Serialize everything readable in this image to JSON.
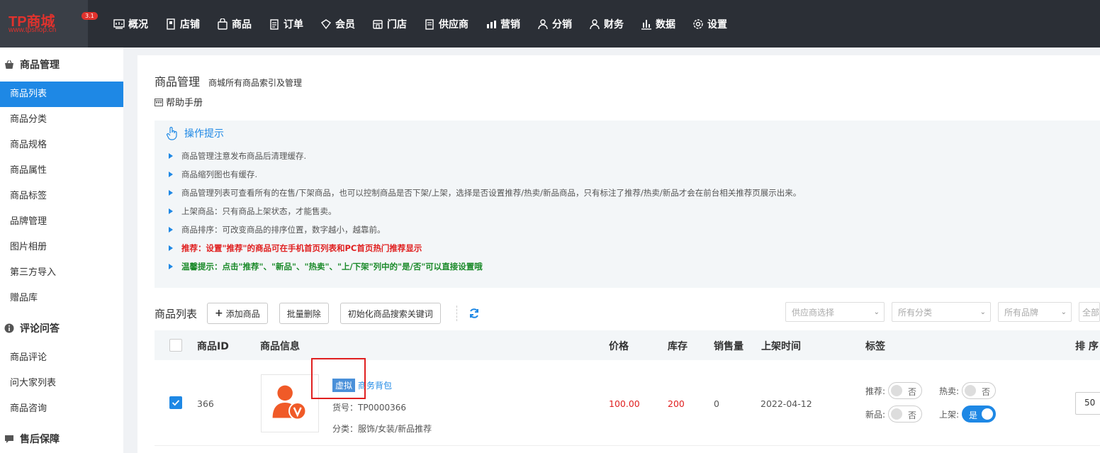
{
  "logo": {
    "main": "TP商城",
    "sub": "www.tpshop.cn",
    "version": "3.1"
  },
  "topnav": [
    {
      "label": "概况",
      "icon": "overview-icon"
    },
    {
      "label": "店铺",
      "icon": "store-icon"
    },
    {
      "label": "商品",
      "icon": "goods-icon"
    },
    {
      "label": "订单",
      "icon": "order-icon"
    },
    {
      "label": "会员",
      "icon": "member-icon"
    },
    {
      "label": "门店",
      "icon": "shop-icon"
    },
    {
      "label": "供应商",
      "icon": "supplier-icon"
    },
    {
      "label": "营销",
      "icon": "marketing-icon"
    },
    {
      "label": "分销",
      "icon": "distribution-icon"
    },
    {
      "label": "财务",
      "icon": "finance-icon"
    },
    {
      "label": "数据",
      "icon": "data-icon"
    },
    {
      "label": "设置",
      "icon": "settings-icon"
    }
  ],
  "sidebar": {
    "group1": "商品管理",
    "items1": [
      "商品列表",
      "商品分类",
      "商品规格",
      "商品属性",
      "商品标签",
      "品牌管理",
      "图片相册",
      "第三方导入",
      "赠品库"
    ],
    "group2": "评论问答",
    "items2": [
      "商品评论",
      "问大家列表",
      "商品咨询"
    ],
    "group3": "售后保障"
  },
  "page": {
    "title": "商品管理",
    "desc": "商城所有商品索引及管理",
    "help": "帮助手册"
  },
  "tips": {
    "title": "操作提示",
    "items": [
      "商品管理注意发布商品后清理缓存.",
      "商品缩列图也有缓存.",
      "商品管理列表可查看所有的在售/下架商品，也可以控制商品是否下架/上架，选择是否设置推荐/热卖/新品商品，只有标注了推荐/热卖/新品才会在前台相关推荐页展示出来。",
      "上架商品：只有商品上架状态，才能售卖。",
      "商品排序：可改变商品的排序位置，数字越小，越靠前。",
      "推荐：设置\"推荐\"的商品可在手机首页列表和PC首页热门推荐显示",
      "温馨提示：点击\"推荐\"、\"新品\"、\"热卖\"、\"上/下架\"列中的\"是/否\"可以直接设置哦"
    ]
  },
  "toolbar": {
    "title": "商品列表",
    "add": "添加商品",
    "batch_delete": "批量删除",
    "init_keywords": "初始化商品搜索关键词",
    "supplier_placeholder": "供应商选择",
    "category_placeholder": "所有分类",
    "brand_placeholder": "所有品牌",
    "all_placeholder": "全部"
  },
  "table": {
    "headers": {
      "id": "商品ID",
      "info": "商品信息",
      "price": "价格",
      "stock": "库存",
      "sales": "销售量",
      "time": "上架时间",
      "tags": "标签",
      "sort": "排 序"
    },
    "row": {
      "checked": true,
      "id": "366",
      "virtual_tag": "虚拟",
      "name": "商务背包",
      "sku": "货号：TP0000366",
      "category": "分类：服饰/女装/新品推荐",
      "price": "100.00",
      "stock": "200",
      "sales": "0",
      "time": "2022-04-12",
      "recommend_label": "推荐:",
      "recommend_value": "否",
      "hot_label": "热卖:",
      "hot_value": "否",
      "new_label": "新品:",
      "new_value": "否",
      "onsale_label": "上架:",
      "onsale_value": "是",
      "sort": "50"
    }
  },
  "colors": {
    "accent": "#1e88e5",
    "topbar": "#2b2f36",
    "red": "#e02020",
    "green": "#1b8a2a",
    "virtual": "#4a90d9"
  }
}
